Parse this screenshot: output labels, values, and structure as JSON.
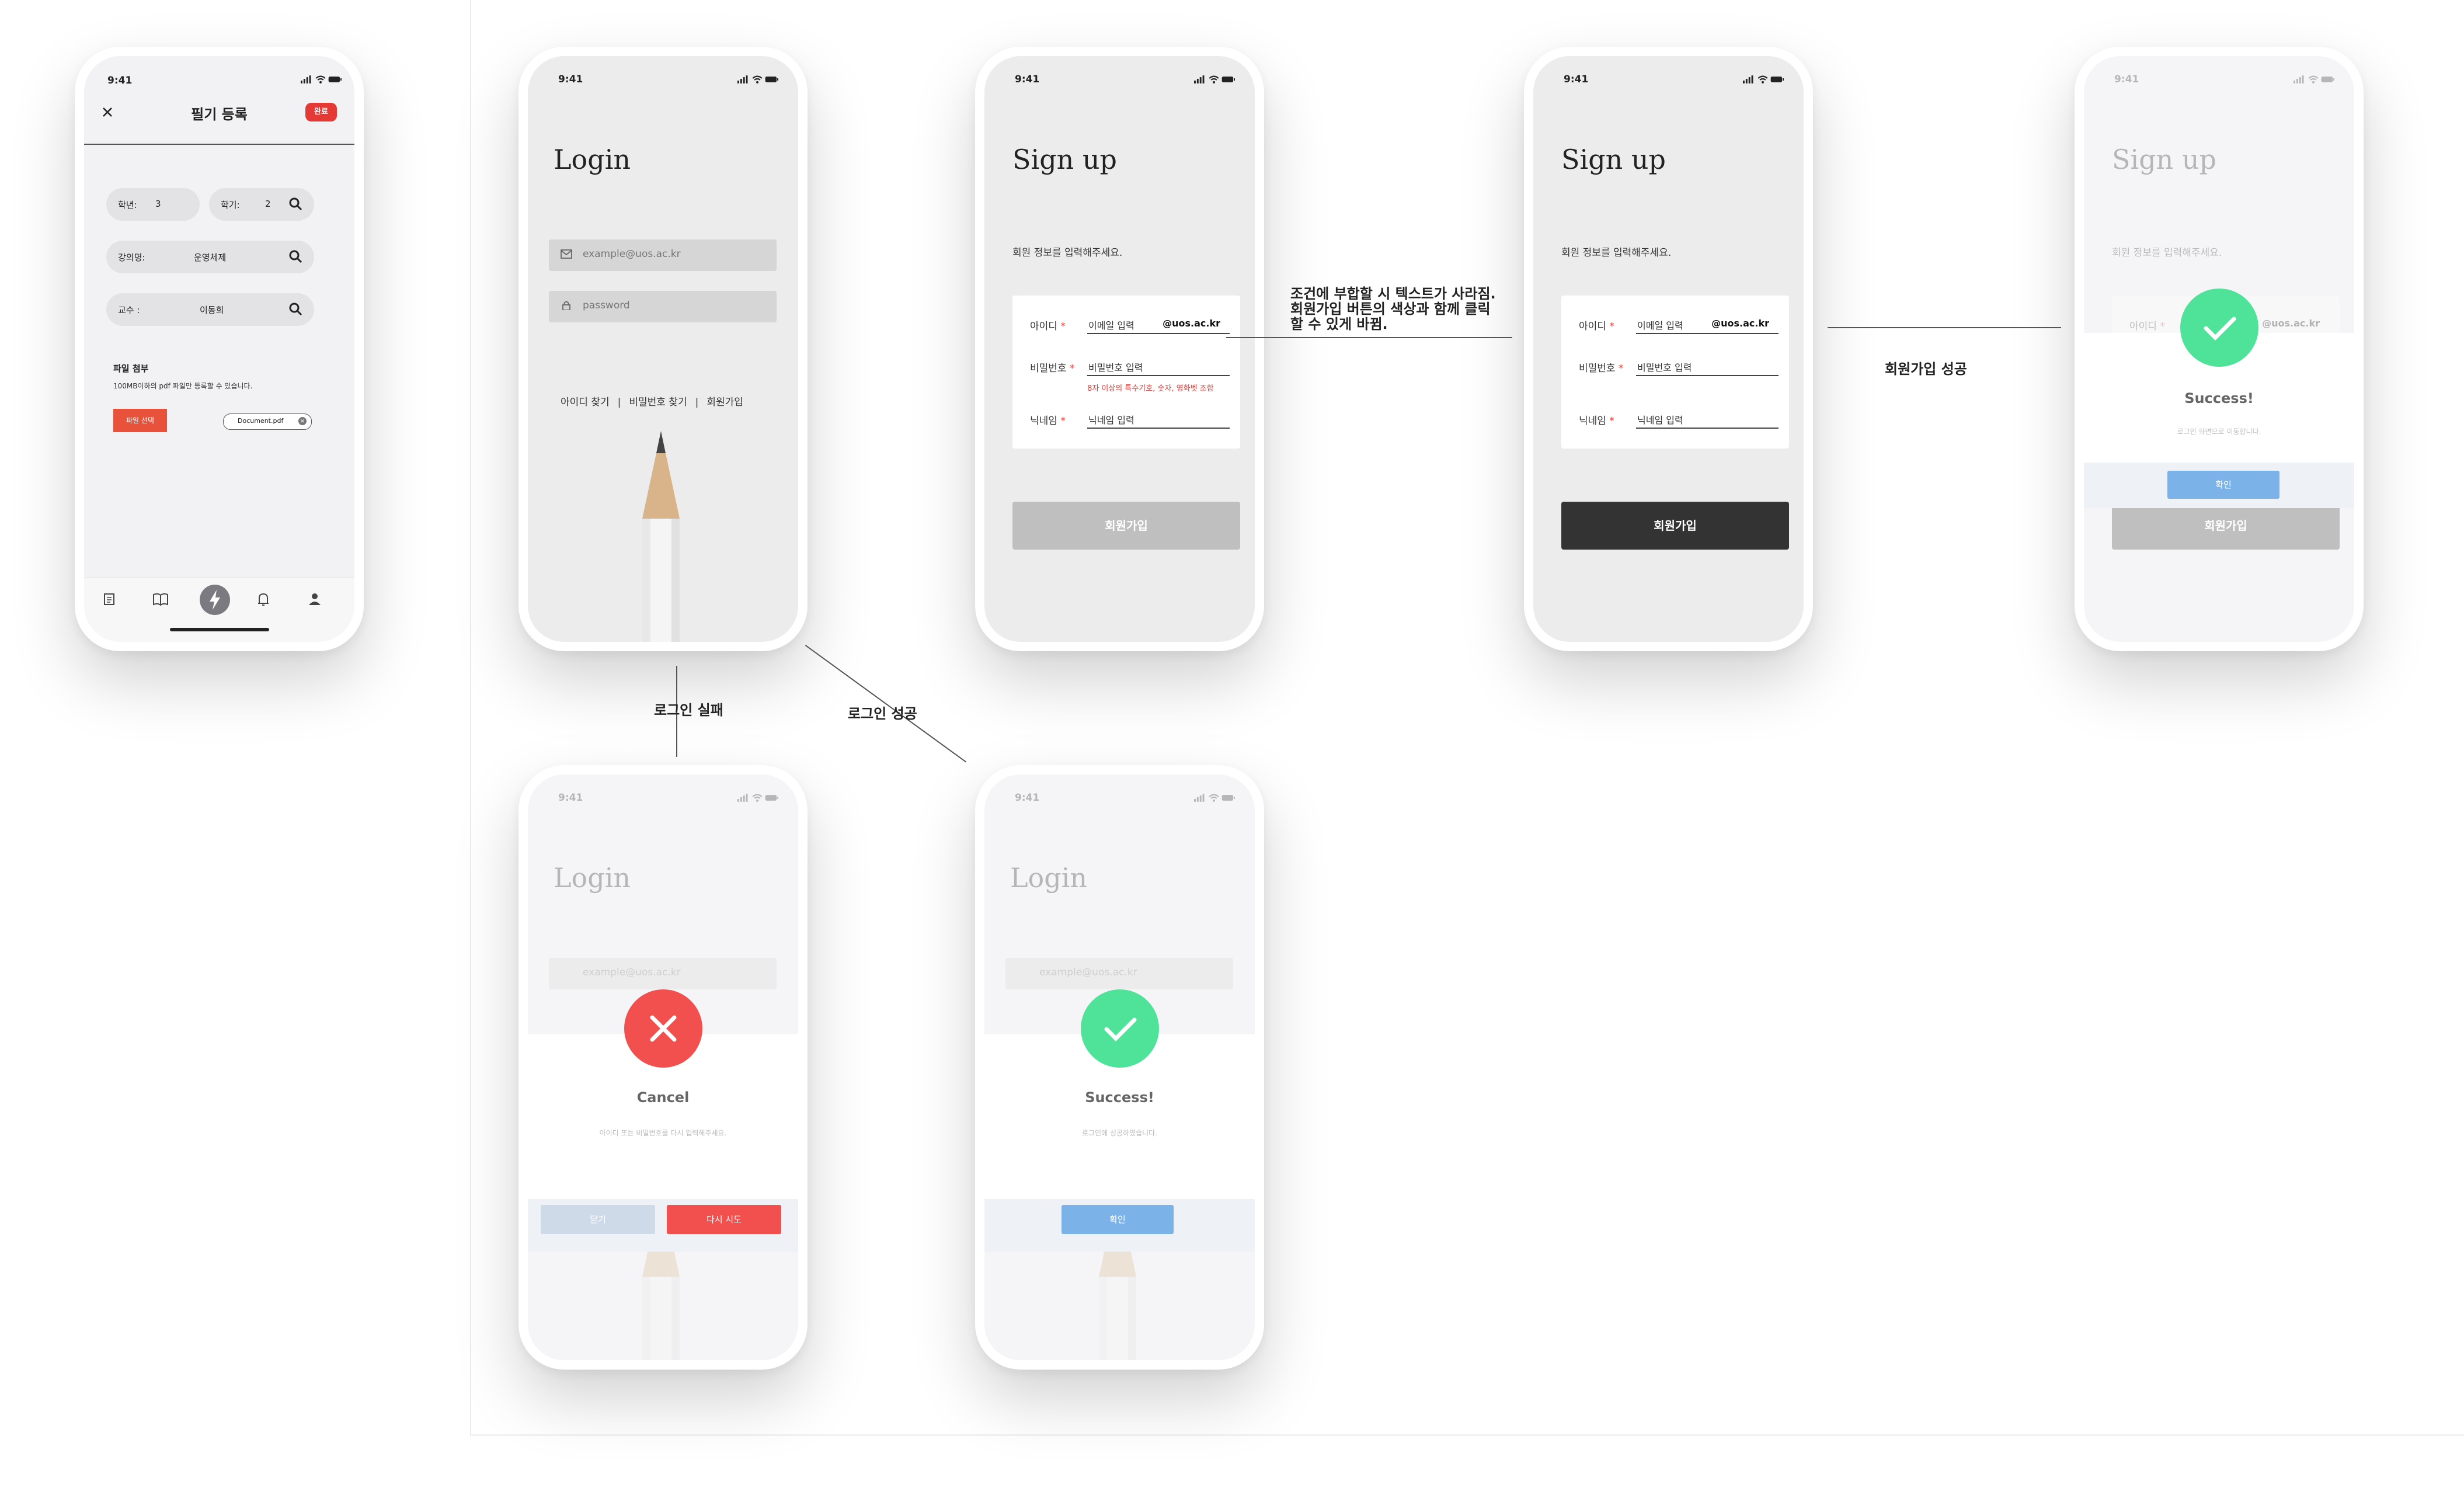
{
  "status_time": "9:41",
  "note_register": {
    "title": "필기 등록",
    "done_label": "완료",
    "grade_label": "학년:",
    "grade_value": "3",
    "semester_label": "학기:",
    "semester_value": "2",
    "course_label": "강의명:",
    "course_value": "운영체제",
    "professor_label": "교수 :",
    "professor_value": "이동희",
    "attach_title": "파일 첨부",
    "attach_desc": "100MB이하의 pdf 파일만 등록할 수 있습니다.",
    "select_file_label": "파일 선택",
    "file_name": "Document.pdf"
  },
  "login": {
    "title": "Login",
    "email_placeholder": "example@uos.ac.kr",
    "password_placeholder": "password",
    "find_id": "아이디 찾기",
    "find_pw": "비밀번호 찾기",
    "signup": "회원가입"
  },
  "signup": {
    "title": "Sign up",
    "subtitle": "회원 정보를 입력해주세요.",
    "id_label": "아이디",
    "id_placeholder": "이메일 입력",
    "domain": "@uos.ac.kr",
    "pw_label": "비밀번호",
    "pw_placeholder": "비밀번호 입력",
    "pw_error": "8자 이상의 특수기호, 숫자, 영화벳 조합",
    "nick_label": "닉네임",
    "nick_placeholder": "닉네임 입력",
    "submit_label": "회원가입",
    "required_mark": "*"
  },
  "signup_success": {
    "title": "Success!",
    "message": "로그인 화면으로 이동합니다.",
    "confirm_label": "확인"
  },
  "login_fail": {
    "title": "Cancel",
    "message": "아이디 또는 비밀번호를 다시 입력해주세요.",
    "close_label": "닫기",
    "retry_label": "다시 시도"
  },
  "login_success": {
    "title": "Success!",
    "message": "로그인에 성공하였습니다.",
    "confirm_label": "확인"
  },
  "annotations": {
    "condition_line1": "조건에 부합할 시  텍스트가 사라짐.",
    "condition_line2": "회원가입 버튼의 색상과 함께 클릭",
    "condition_line3": "할 수 있게 바뀜.",
    "signup_success": "회원가입 성공",
    "login_fail": "로그인 실패",
    "login_success": "로그인 성공"
  },
  "colors": {
    "accent_red": "#e53935",
    "success_green": "#4fe39a",
    "cancel_red": "#f24f4f",
    "confirm_blue": "#7bb3e8",
    "dark_button": "#333333"
  }
}
